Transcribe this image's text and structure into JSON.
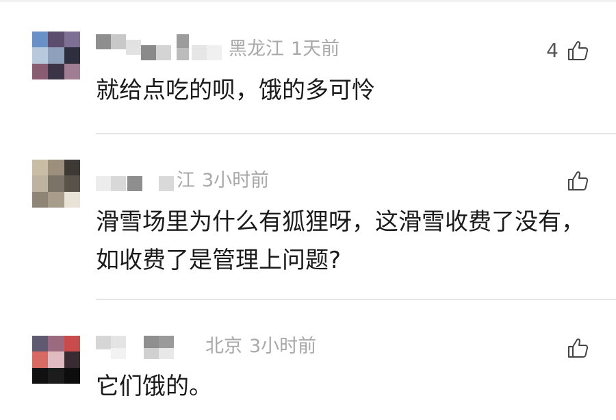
{
  "comments": [
    {
      "location": "黑龙江",
      "time": "1天前",
      "likes": "4",
      "text": "就给点吃的呗，饿的多可怜",
      "avatar_colors": [
        "#6a90c8",
        "#5c4d6e",
        "#7e6f95",
        "#b8c9de",
        "#8fa0bd",
        "#2e2e3e",
        "#8a5c72",
        "#3b3446",
        "#a07d92"
      ]
    },
    {
      "location": "江",
      "time": "3小时前",
      "likes": "",
      "text": "滑雪场里为什么有狐狸呀，这滑雪收费了没有，如收费了是管理上问题?",
      "avatar_colors": [
        "#c9bda6",
        "#9c8f7b",
        "#3d3a36",
        "#bdb3a0",
        "#7b7466",
        "#585249",
        "#8f8576",
        "#a89c8b",
        "#e9e2d6"
      ]
    },
    {
      "location": "北京",
      "time": "3小时前",
      "likes": "",
      "text": "它们饿的。",
      "avatar_colors": [
        "#5f5a72",
        "#9b6a7e",
        "#c94b4b",
        "#d86a64",
        "#e0bcc0",
        "#3a2b32",
        "#111111",
        "#1c1c1c",
        "#0d0d0d"
      ]
    }
  ]
}
